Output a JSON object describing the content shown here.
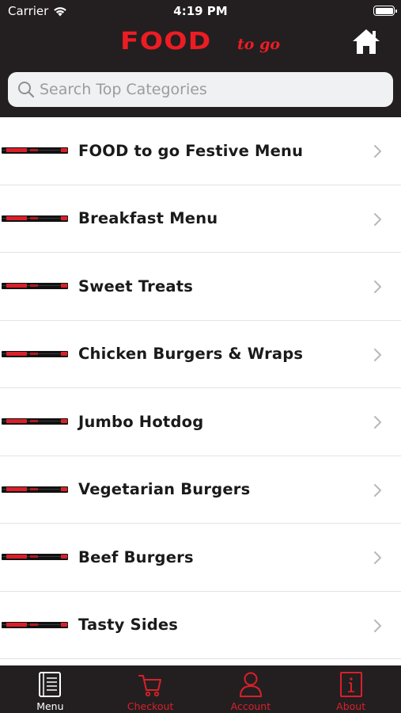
{
  "status_bar": {
    "carrier": "Carrier",
    "time": "4:19 PM"
  },
  "header": {
    "logo_main": "FOOD",
    "logo_sub": "to go",
    "home_icon": "home-icon"
  },
  "search": {
    "placeholder": "Search Top Categories",
    "value": ""
  },
  "categories": [
    {
      "label": "FOOD to go Festive Menu"
    },
    {
      "label": "Breakfast Menu"
    },
    {
      "label": "Sweet Treats"
    },
    {
      "label": "Chicken Burgers & Wraps"
    },
    {
      "label": "Jumbo Hotdog"
    },
    {
      "label": "Vegetarian Burgers"
    },
    {
      "label": "Beef Burgers"
    },
    {
      "label": "Tasty Sides"
    }
  ],
  "tab_bar": {
    "tabs": [
      {
        "label": "Menu",
        "icon": "menu-book-icon",
        "active": true
      },
      {
        "label": "Checkout",
        "icon": "cart-icon",
        "active": false
      },
      {
        "label": "Account",
        "icon": "person-icon",
        "active": false
      },
      {
        "label": "About",
        "icon": "info-icon",
        "active": false
      }
    ]
  },
  "colors": {
    "header_bg": "#231f20",
    "brand_red": "#ed1c24",
    "tab_inactive": "#d9202a",
    "tab_active": "#ffffff"
  }
}
